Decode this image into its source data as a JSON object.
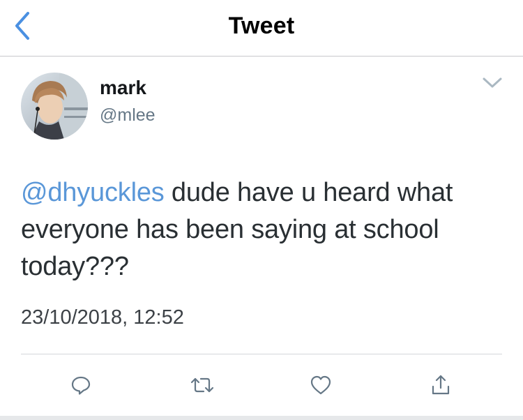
{
  "navbar": {
    "title": "Tweet",
    "back_icon": "chevron-left-icon",
    "accent_color": "#1da1f2"
  },
  "tweet": {
    "author": {
      "display_name": "mark",
      "handle": "@mlee"
    },
    "mention": "@dhyuckles",
    "text": " dude have u heard what everyone has been saying at school today???",
    "timestamp": "23/10/2018, 12:52",
    "mention_color": "#5a97d8"
  },
  "actions": {
    "icons": [
      "reply-icon",
      "retweet-icon",
      "like-icon",
      "share-icon"
    ]
  }
}
